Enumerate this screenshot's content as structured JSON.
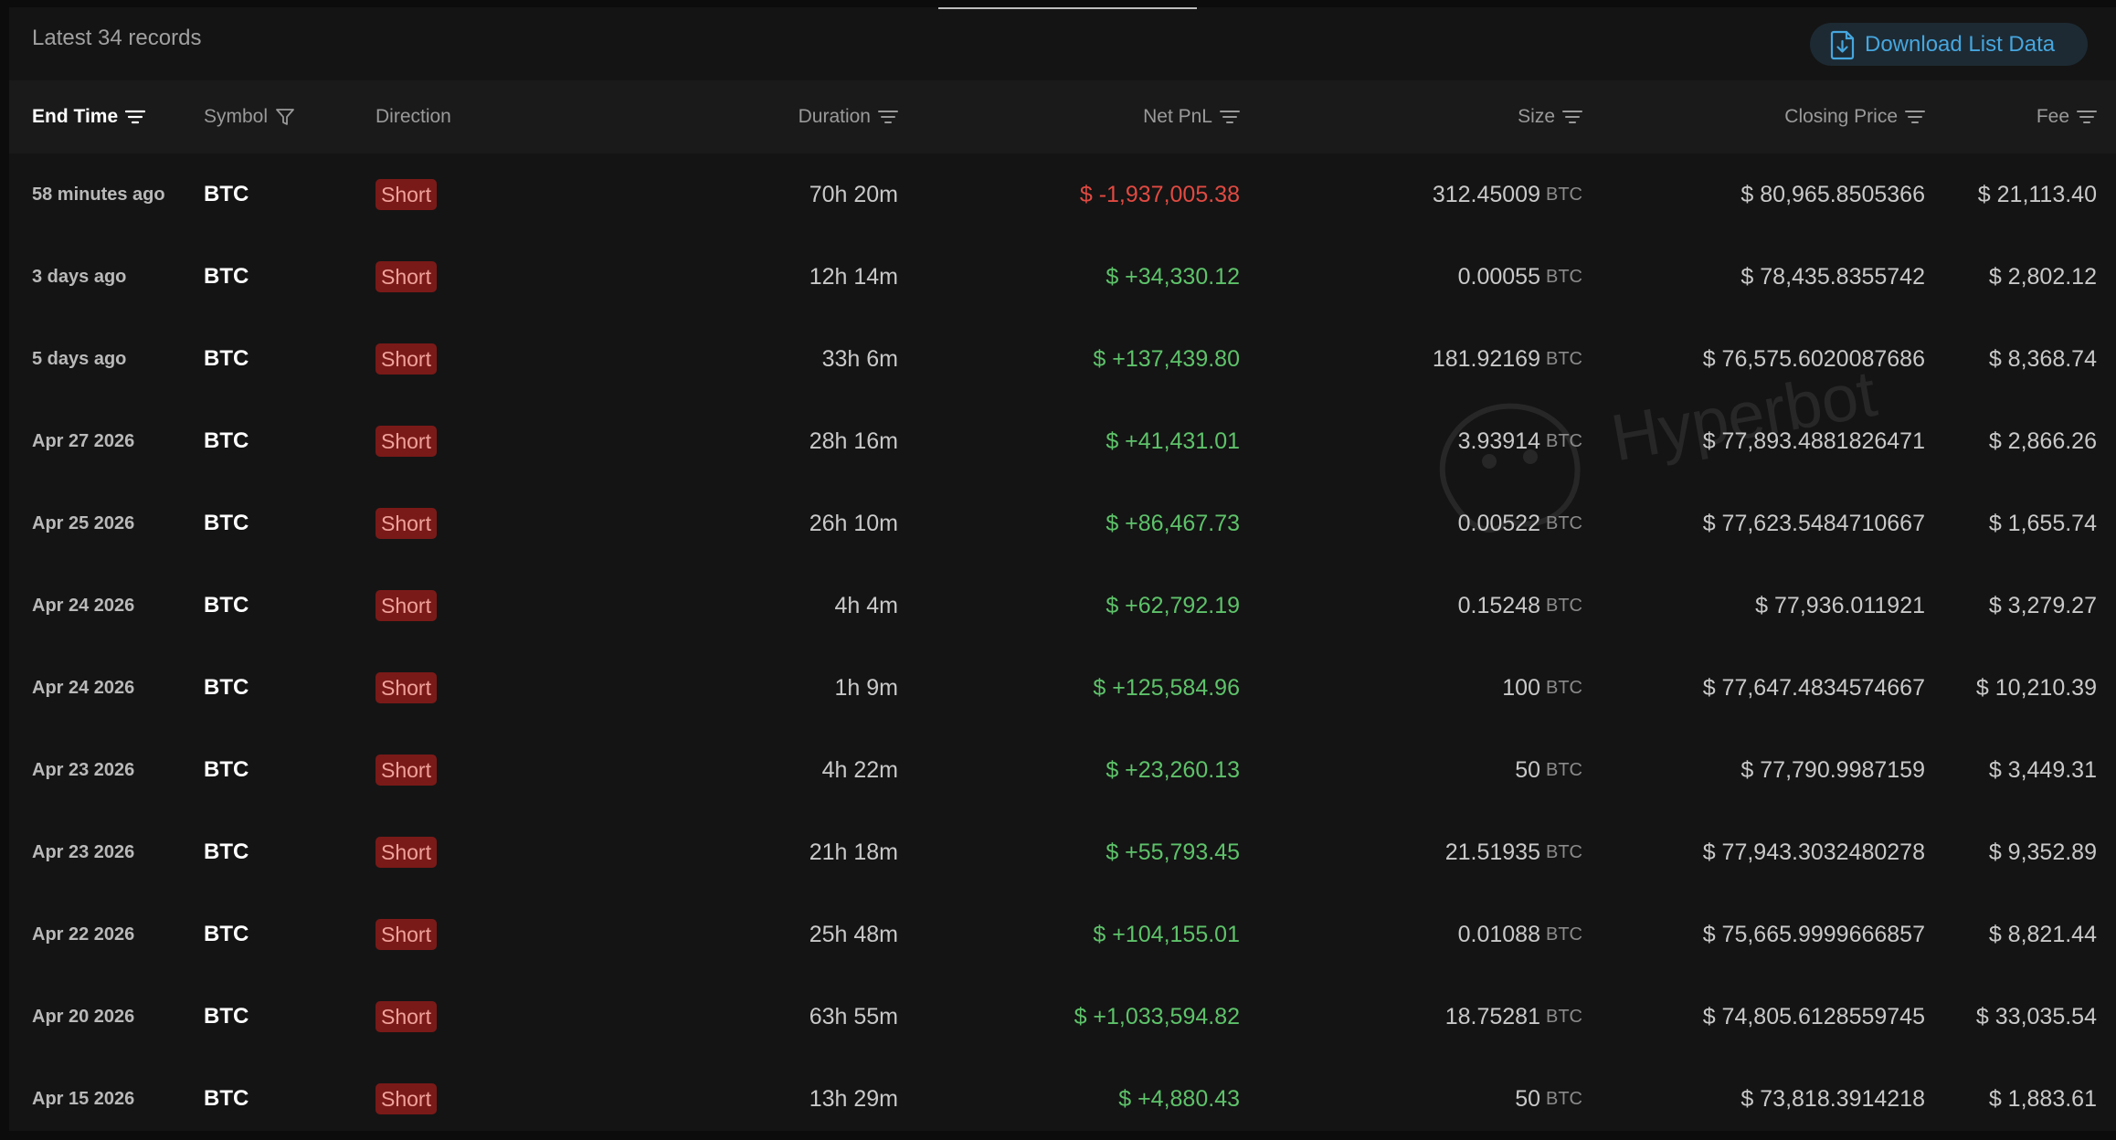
{
  "header": {
    "records_label": "Latest 34 records",
    "download_label": "Download List Data",
    "download_icon": "download-file-icon",
    "accent_color": "#46a6de"
  },
  "watermark": {
    "text": "Hyperbot"
  },
  "table": {
    "columns": {
      "end_time": "End Time",
      "symbol": "Symbol",
      "direction": "Direction",
      "duration": "Duration",
      "net_pnl": "Net PnL",
      "size": "Size",
      "closing_price": "Closing Price",
      "fee": "Fee"
    },
    "rows": [
      {
        "end_time": "58 minutes ago",
        "symbol": "BTC",
        "direction": "Short",
        "duration": "70h 20m",
        "net_pnl": "$ -1,937,005.38",
        "pnl_sign": "negative",
        "size": "312.45009",
        "size_unit": "BTC",
        "closing_price": "$ 80,965.8505366",
        "fee": "$ 21,113.40"
      },
      {
        "end_time": "3 days ago",
        "symbol": "BTC",
        "direction": "Short",
        "duration": "12h 14m",
        "net_pnl": "$ +34,330.12",
        "pnl_sign": "positive",
        "size": "0.00055",
        "size_unit": "BTC",
        "closing_price": "$ 78,435.8355742",
        "fee": "$ 2,802.12"
      },
      {
        "end_time": "5 days ago",
        "symbol": "BTC",
        "direction": "Short",
        "duration": "33h 6m",
        "net_pnl": "$ +137,439.80",
        "pnl_sign": "positive",
        "size": "181.92169",
        "size_unit": "BTC",
        "closing_price": "$ 76,575.6020087686",
        "fee": "$ 8,368.74"
      },
      {
        "end_time": "Apr 27 2026",
        "symbol": "BTC",
        "direction": "Short",
        "duration": "28h 16m",
        "net_pnl": "$ +41,431.01",
        "pnl_sign": "positive",
        "size": "3.93914",
        "size_unit": "BTC",
        "closing_price": "$ 77,893.4881826471",
        "fee": "$ 2,866.26"
      },
      {
        "end_time": "Apr 25 2026",
        "symbol": "BTC",
        "direction": "Short",
        "duration": "26h 10m",
        "net_pnl": "$ +86,467.73",
        "pnl_sign": "positive",
        "size": "0.00522",
        "size_unit": "BTC",
        "closing_price": "$ 77,623.5484710667",
        "fee": "$ 1,655.74"
      },
      {
        "end_time": "Apr 24 2026",
        "symbol": "BTC",
        "direction": "Short",
        "duration": "4h 4m",
        "net_pnl": "$ +62,792.19",
        "pnl_sign": "positive",
        "size": "0.15248",
        "size_unit": "BTC",
        "closing_price": "$ 77,936.011921",
        "fee": "$ 3,279.27"
      },
      {
        "end_time": "Apr 24 2026",
        "symbol": "BTC",
        "direction": "Short",
        "duration": "1h 9m",
        "net_pnl": "$ +125,584.96",
        "pnl_sign": "positive",
        "size": "100",
        "size_unit": "BTC",
        "closing_price": "$ 77,647.4834574667",
        "fee": "$ 10,210.39"
      },
      {
        "end_time": "Apr 23 2026",
        "symbol": "BTC",
        "direction": "Short",
        "duration": "4h 22m",
        "net_pnl": "$ +23,260.13",
        "pnl_sign": "positive",
        "size": "50",
        "size_unit": "BTC",
        "closing_price": "$ 77,790.9987159",
        "fee": "$ 3,449.31"
      },
      {
        "end_time": "Apr 23 2026",
        "symbol": "BTC",
        "direction": "Short",
        "duration": "21h 18m",
        "net_pnl": "$ +55,793.45",
        "pnl_sign": "positive",
        "size": "21.51935",
        "size_unit": "BTC",
        "closing_price": "$ 77,943.3032480278",
        "fee": "$ 9,352.89"
      },
      {
        "end_time": "Apr 22 2026",
        "symbol": "BTC",
        "direction": "Short",
        "duration": "25h 48m",
        "net_pnl": "$ +104,155.01",
        "pnl_sign": "positive",
        "size": "0.01088",
        "size_unit": "BTC",
        "closing_price": "$ 75,665.9999666857",
        "fee": "$ 8,821.44"
      },
      {
        "end_time": "Apr 20 2026",
        "symbol": "BTC",
        "direction": "Short",
        "duration": "63h 55m",
        "net_pnl": "$ +1,033,594.82",
        "pnl_sign": "positive",
        "size": "18.75281",
        "size_unit": "BTC",
        "closing_price": "$ 74,805.6128559745",
        "fee": "$ 33,035.54"
      },
      {
        "end_time": "Apr 15 2026",
        "symbol": "BTC",
        "direction": "Short",
        "duration": "13h 29m",
        "net_pnl": "$ +4,880.43",
        "pnl_sign": "positive",
        "size": "50",
        "size_unit": "BTC",
        "closing_price": "$ 73,818.3914218",
        "fee": "$ 1,883.61"
      }
    ]
  },
  "colors": {
    "positive": "#5ec26a",
    "negative": "#e04a42",
    "short_badge_bg": "#7a1a18",
    "short_badge_text": "#f0a29a"
  }
}
